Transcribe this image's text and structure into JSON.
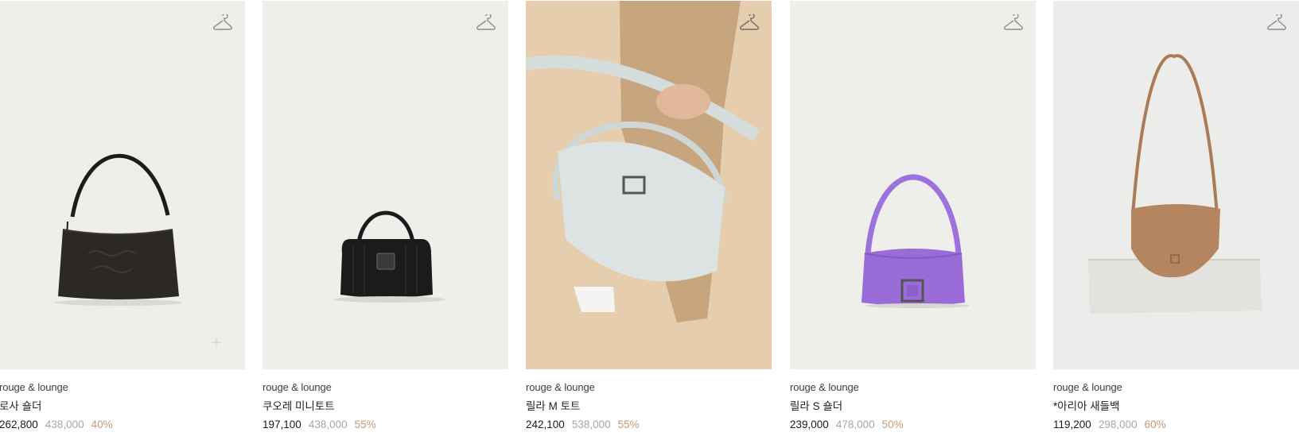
{
  "products": [
    {
      "brand": "rouge & lounge",
      "name": "로사 숄더",
      "price": "262,800",
      "original_price": "438,000",
      "discount": "40%",
      "color": "#2b2826",
      "icon": "hanger-icon"
    },
    {
      "brand": "rouge & lounge",
      "name": "쿠오레 미니토트",
      "price": "197,100",
      "original_price": "438,000",
      "discount": "55%",
      "color": "#1b1b1b",
      "icon": "hanger-icon"
    },
    {
      "brand": "rouge & lounge",
      "name": "릴라 M 토트",
      "price": "242,100",
      "original_price": "538,000",
      "discount": "55%",
      "color": "#dde3e2",
      "icon": "hanger-icon"
    },
    {
      "brand": "rouge & lounge",
      "name": "릴라 S 숄더",
      "price": "239,000",
      "original_price": "478,000",
      "discount": "50%",
      "color": "#9a6cd8",
      "icon": "hanger-icon"
    },
    {
      "brand": "rouge & lounge",
      "name": "*아리아 새들백",
      "price": "119,200",
      "original_price": "298,000",
      "discount": "60%",
      "color": "#b5855f",
      "icon": "hanger-icon"
    }
  ],
  "colors": {
    "card_bg": "#eeeeea",
    "discount": "#c59a78",
    "original_price": "#a6a6a6"
  }
}
